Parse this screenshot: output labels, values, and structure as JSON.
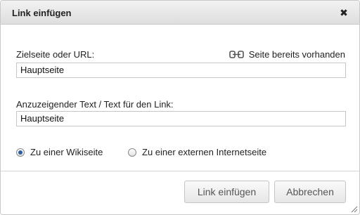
{
  "dialog": {
    "title": "Link einfügen",
    "close_symbol": "✖",
    "close_icon": "close-icon"
  },
  "target": {
    "label": "Zielseite oder URL:",
    "value": "Hauptseite",
    "status_text": "Seite bereits vorhanden",
    "status_icon": "link-exists-icon"
  },
  "display_text": {
    "label": "Anzuzeigender Text / Text für den Link:",
    "value": "Hauptseite"
  },
  "link_type": {
    "options": [
      {
        "label": "Zu einer Wikiseite",
        "checked": true
      },
      {
        "label": "Zu einer externen Internetseite",
        "checked": false
      }
    ]
  },
  "buttons": {
    "insert_label": "Link einfügen",
    "cancel_label": "Abbrechen"
  },
  "colors": {
    "titlebar": "#e6e6e6",
    "radio_checked": "#2b5f9e",
    "border": "#c6c6c6"
  }
}
